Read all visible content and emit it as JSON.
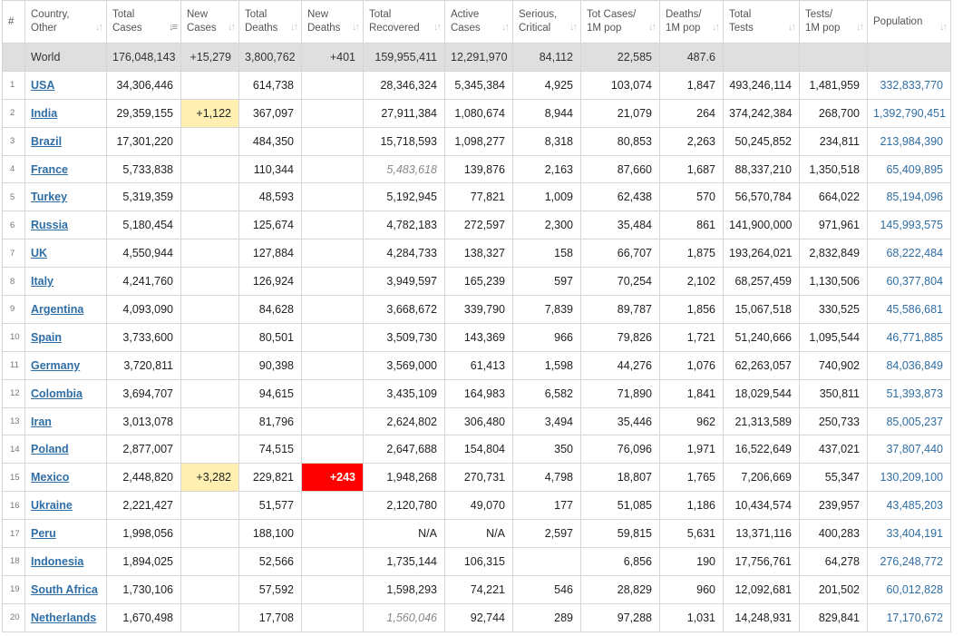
{
  "headers": {
    "num": "#",
    "country": [
      "Country,",
      "Other"
    ],
    "total_cases": [
      "Total",
      "Cases"
    ],
    "new_cases": [
      "New",
      "Cases"
    ],
    "total_deaths": [
      "Total",
      "Deaths"
    ],
    "new_deaths": [
      "New",
      "Deaths"
    ],
    "total_recovered": [
      "Total",
      "Recovered"
    ],
    "active_cases": [
      "Active",
      "Cases"
    ],
    "serious": [
      "Serious,",
      "Critical"
    ],
    "cases_per_m": [
      "Tot Cases/",
      "1M pop"
    ],
    "deaths_per_m": [
      "Deaths/",
      "1M pop"
    ],
    "total_tests": [
      "Total",
      "Tests"
    ],
    "tests_per_m": [
      "Tests/",
      "1M pop"
    ],
    "population": [
      "Population"
    ]
  },
  "sort_icon": "sort-arrows-icon",
  "colors": {
    "link": "#2f6ea5",
    "new_cases_highlight": "#fff0b2",
    "new_deaths_highlight": "#ff0000",
    "world_row_bg": "#dfdfdf"
  },
  "world": {
    "country": "World",
    "total_cases": "176,048,143",
    "new_cases": "+15,279",
    "total_deaths": "3,800,762",
    "new_deaths": "+401",
    "total_recovered": "159,955,411",
    "active_cases": "12,291,970",
    "serious": "84,112",
    "cases_per_m": "22,585",
    "deaths_per_m": "487.6",
    "total_tests": "",
    "tests_per_m": "",
    "population": ""
  },
  "rows": [
    {
      "num": "1",
      "country": "USA",
      "total_cases": "34,306,446",
      "new_cases": "",
      "total_deaths": "614,738",
      "new_deaths": "",
      "total_recovered": "28,346,324",
      "active_cases": "5,345,384",
      "serious": "4,925",
      "cases_per_m": "103,074",
      "deaths_per_m": "1,847",
      "total_tests": "493,246,114",
      "tests_per_m": "1,481,959",
      "population": "332,833,770"
    },
    {
      "num": "2",
      "country": "India",
      "total_cases": "29,359,155",
      "new_cases": "+1,122",
      "total_deaths": "367,097",
      "new_deaths": "",
      "total_recovered": "27,911,384",
      "active_cases": "1,080,674",
      "serious": "8,944",
      "cases_per_m": "21,079",
      "deaths_per_m": "264",
      "total_tests": "374,242,384",
      "tests_per_m": "268,700",
      "population": "1,392,790,451"
    },
    {
      "num": "3",
      "country": "Brazil",
      "total_cases": "17,301,220",
      "new_cases": "",
      "total_deaths": "484,350",
      "new_deaths": "",
      "total_recovered": "15,718,593",
      "active_cases": "1,098,277",
      "serious": "8,318",
      "cases_per_m": "80,853",
      "deaths_per_m": "2,263",
      "total_tests": "50,245,852",
      "tests_per_m": "234,811",
      "population": "213,984,390"
    },
    {
      "num": "4",
      "country": "France",
      "total_cases": "5,733,838",
      "new_cases": "",
      "total_deaths": "110,344",
      "new_deaths": "",
      "total_recovered": "5,483,618",
      "active_cases": "139,876",
      "serious": "2,163",
      "cases_per_m": "87,660",
      "deaths_per_m": "1,687",
      "total_tests": "88,337,210",
      "tests_per_m": "1,350,518",
      "population": "65,409,895"
    },
    {
      "num": "5",
      "country": "Turkey",
      "total_cases": "5,319,359",
      "new_cases": "",
      "total_deaths": "48,593",
      "new_deaths": "",
      "total_recovered": "5,192,945",
      "active_cases": "77,821",
      "serious": "1,009",
      "cases_per_m": "62,438",
      "deaths_per_m": "570",
      "total_tests": "56,570,784",
      "tests_per_m": "664,022",
      "population": "85,194,096"
    },
    {
      "num": "6",
      "country": "Russia",
      "total_cases": "5,180,454",
      "new_cases": "",
      "total_deaths": "125,674",
      "new_deaths": "",
      "total_recovered": "4,782,183",
      "active_cases": "272,597",
      "serious": "2,300",
      "cases_per_m": "35,484",
      "deaths_per_m": "861",
      "total_tests": "141,900,000",
      "tests_per_m": "971,961",
      "population": "145,993,575"
    },
    {
      "num": "7",
      "country": "UK",
      "total_cases": "4,550,944",
      "new_cases": "",
      "total_deaths": "127,884",
      "new_deaths": "",
      "total_recovered": "4,284,733",
      "active_cases": "138,327",
      "serious": "158",
      "cases_per_m": "66,707",
      "deaths_per_m": "1,875",
      "total_tests": "193,264,021",
      "tests_per_m": "2,832,849",
      "population": "68,222,484"
    },
    {
      "num": "8",
      "country": "Italy",
      "total_cases": "4,241,760",
      "new_cases": "",
      "total_deaths": "126,924",
      "new_deaths": "",
      "total_recovered": "3,949,597",
      "active_cases": "165,239",
      "serious": "597",
      "cases_per_m": "70,254",
      "deaths_per_m": "2,102",
      "total_tests": "68,257,459",
      "tests_per_m": "1,130,506",
      "population": "60,377,804"
    },
    {
      "num": "9",
      "country": "Argentina",
      "total_cases": "4,093,090",
      "new_cases": "",
      "total_deaths": "84,628",
      "new_deaths": "",
      "total_recovered": "3,668,672",
      "active_cases": "339,790",
      "serious": "7,839",
      "cases_per_m": "89,787",
      "deaths_per_m": "1,856",
      "total_tests": "15,067,518",
      "tests_per_m": "330,525",
      "population": "45,586,681"
    },
    {
      "num": "10",
      "country": "Spain",
      "total_cases": "3,733,600",
      "new_cases": "",
      "total_deaths": "80,501",
      "new_deaths": "",
      "total_recovered": "3,509,730",
      "active_cases": "143,369",
      "serious": "966",
      "cases_per_m": "79,826",
      "deaths_per_m": "1,721",
      "total_tests": "51,240,666",
      "tests_per_m": "1,095,544",
      "population": "46,771,885"
    },
    {
      "num": "11",
      "country": "Germany",
      "total_cases": "3,720,811",
      "new_cases": "",
      "total_deaths": "90,398",
      "new_deaths": "",
      "total_recovered": "3,569,000",
      "active_cases": "61,413",
      "serious": "1,598",
      "cases_per_m": "44,276",
      "deaths_per_m": "1,076",
      "total_tests": "62,263,057",
      "tests_per_m": "740,902",
      "population": "84,036,849"
    },
    {
      "num": "12",
      "country": "Colombia",
      "total_cases": "3,694,707",
      "new_cases": "",
      "total_deaths": "94,615",
      "new_deaths": "",
      "total_recovered": "3,435,109",
      "active_cases": "164,983",
      "serious": "6,582",
      "cases_per_m": "71,890",
      "deaths_per_m": "1,841",
      "total_tests": "18,029,544",
      "tests_per_m": "350,811",
      "population": "51,393,873"
    },
    {
      "num": "13",
      "country": "Iran",
      "total_cases": "3,013,078",
      "new_cases": "",
      "total_deaths": "81,796",
      "new_deaths": "",
      "total_recovered": "2,624,802",
      "active_cases": "306,480",
      "serious": "3,494",
      "cases_per_m": "35,446",
      "deaths_per_m": "962",
      "total_tests": "21,313,589",
      "tests_per_m": "250,733",
      "population": "85,005,237"
    },
    {
      "num": "14",
      "country": "Poland",
      "total_cases": "2,877,007",
      "new_cases": "",
      "total_deaths": "74,515",
      "new_deaths": "",
      "total_recovered": "2,647,688",
      "active_cases": "154,804",
      "serious": "350",
      "cases_per_m": "76,096",
      "deaths_per_m": "1,971",
      "total_tests": "16,522,649",
      "tests_per_m": "437,021",
      "population": "37,807,440"
    },
    {
      "num": "15",
      "country": "Mexico",
      "total_cases": "2,448,820",
      "new_cases": "+3,282",
      "total_deaths": "229,821",
      "new_deaths": "+243",
      "total_recovered": "1,948,268",
      "active_cases": "270,731",
      "serious": "4,798",
      "cases_per_m": "18,807",
      "deaths_per_m": "1,765",
      "total_tests": "7,206,669",
      "tests_per_m": "55,347",
      "population": "130,209,100"
    },
    {
      "num": "16",
      "country": "Ukraine",
      "total_cases": "2,221,427",
      "new_cases": "",
      "total_deaths": "51,577",
      "new_deaths": "",
      "total_recovered": "2,120,780",
      "active_cases": "49,070",
      "serious": "177",
      "cases_per_m": "51,085",
      "deaths_per_m": "1,186",
      "total_tests": "10,434,574",
      "tests_per_m": "239,957",
      "population": "43,485,203"
    },
    {
      "num": "17",
      "country": "Peru",
      "total_cases": "1,998,056",
      "new_cases": "",
      "total_deaths": "188,100",
      "new_deaths": "",
      "total_recovered": "N/A",
      "active_cases": "N/A",
      "serious": "2,597",
      "cases_per_m": "59,815",
      "deaths_per_m": "5,631",
      "total_tests": "13,371,116",
      "tests_per_m": "400,283",
      "population": "33,404,191"
    },
    {
      "num": "18",
      "country": "Indonesia",
      "total_cases": "1,894,025",
      "new_cases": "",
      "total_deaths": "52,566",
      "new_deaths": "",
      "total_recovered": "1,735,144",
      "active_cases": "106,315",
      "serious": "",
      "cases_per_m": "6,856",
      "deaths_per_m": "190",
      "total_tests": "17,756,761",
      "tests_per_m": "64,278",
      "population": "276,248,772"
    },
    {
      "num": "19",
      "country": "South Africa",
      "total_cases": "1,730,106",
      "new_cases": "",
      "total_deaths": "57,592",
      "new_deaths": "",
      "total_recovered": "1,598,293",
      "active_cases": "74,221",
      "serious": "546",
      "cases_per_m": "28,829",
      "deaths_per_m": "960",
      "total_tests": "12,092,681",
      "tests_per_m": "201,502",
      "population": "60,012,828"
    },
    {
      "num": "20",
      "country": "Netherlands",
      "total_cases": "1,670,498",
      "new_cases": "",
      "total_deaths": "17,708",
      "new_deaths": "",
      "total_recovered": "1,560,046",
      "active_cases": "92,744",
      "serious": "289",
      "cases_per_m": "97,288",
      "deaths_per_m": "1,031",
      "total_tests": "14,248,931",
      "tests_per_m": "829,841",
      "population": "17,170,672"
    }
  ]
}
